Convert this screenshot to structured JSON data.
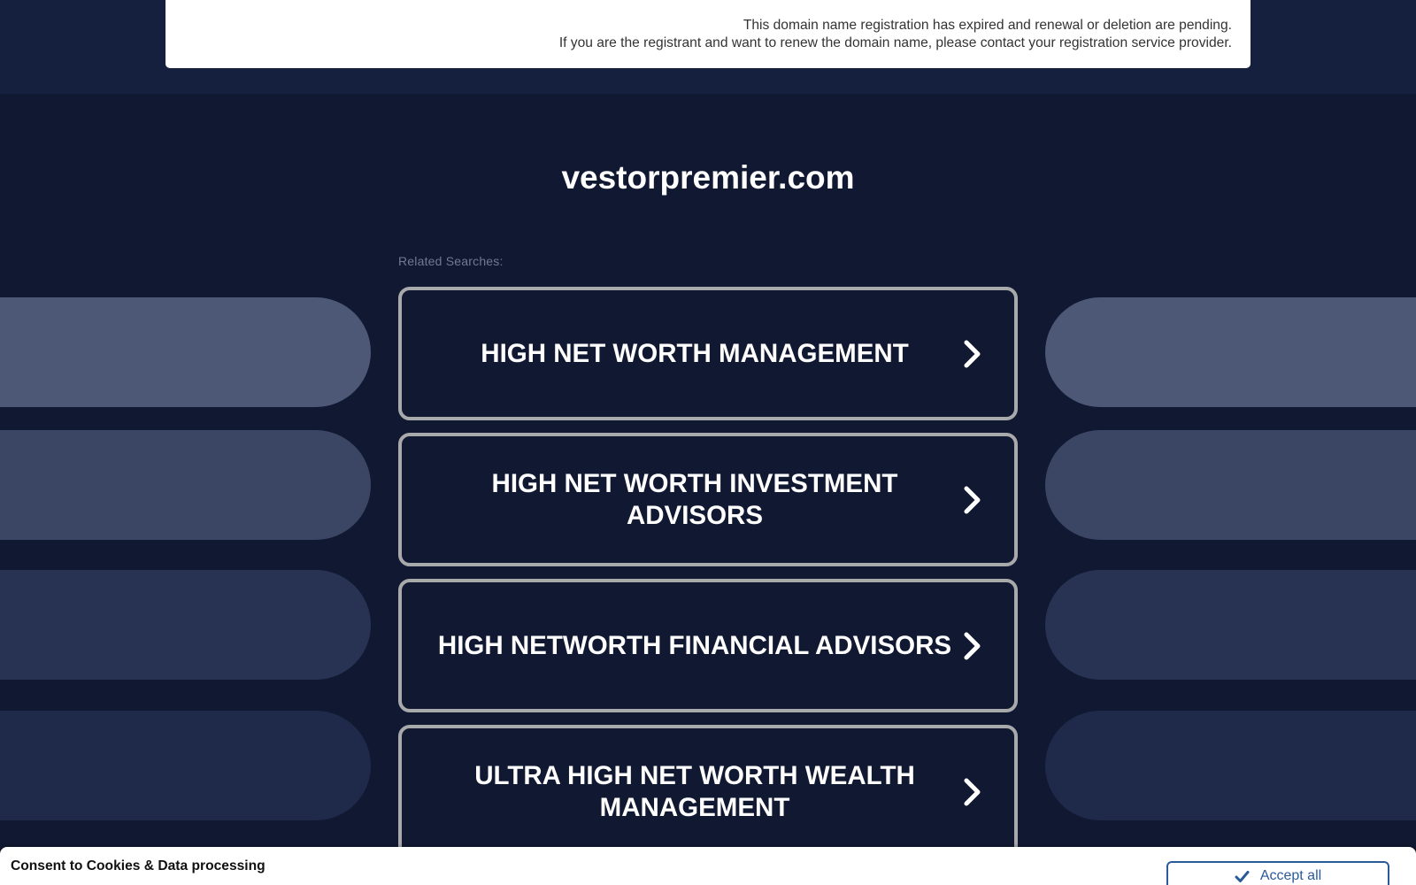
{
  "notice": {
    "line1": "This domain name registration has expired and renewal or deletion are pending.",
    "line2": "If you are the registrant and want to renew the domain name, please contact your registration service provider."
  },
  "domain": "vestorpremier.com",
  "related": {
    "label": "Related Searches:",
    "links": [
      "HIGH NET WORTH MANAGEMENT",
      "HIGH NET WORTH INVESTMENT ADVISORS",
      "HIGH NETWORTH FINANCIAL ADVISORS",
      "ULTRA HIGH NET WORTH WEALTH MANAGEMENT"
    ]
  },
  "consent": {
    "title": "Consent to Cookies & Data processing",
    "accept_label": "Accept all"
  },
  "icons": {
    "link_chevron": "chevron-right-icon",
    "accept": "check-icon"
  },
  "colors": {
    "background": "#111831",
    "top_band": "#14203d",
    "button_border": "#a8a9ab",
    "accept_blue": "#2a5b99"
  }
}
